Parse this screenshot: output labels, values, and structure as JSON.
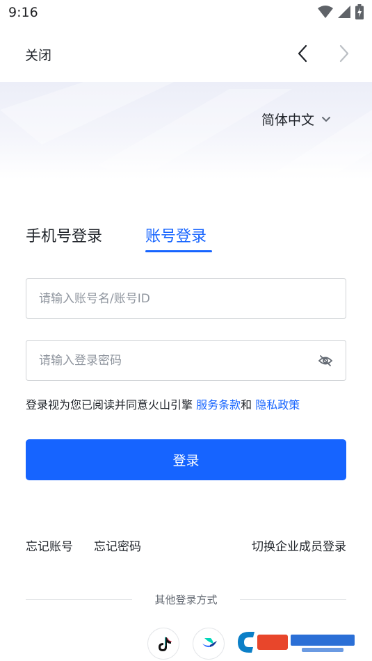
{
  "status_bar": {
    "time": "9:16"
  },
  "nav": {
    "close_label": "关闭"
  },
  "language": {
    "selected": "简体中文"
  },
  "tabs": {
    "phone_login": "手机号登录",
    "account_login": "账号登录"
  },
  "form": {
    "account_placeholder": "请输入账号名/账号ID",
    "account_value": "",
    "password_placeholder": "请输入登录密码",
    "password_value": ""
  },
  "agreement": {
    "prefix": "登录视为您已阅读并同意火山引擎 ",
    "terms_link": "服务条款",
    "and": "和 ",
    "privacy_link": "隐私政策"
  },
  "login_button_label": "登录",
  "links": {
    "forgot_account": "忘记账号",
    "forgot_password": "忘记密码",
    "enterprise_login": "切换企业成员登录"
  },
  "other_login": {
    "label": "其他登录方式"
  },
  "colors": {
    "primary": "#1664ff",
    "text": "#1f2329",
    "placeholder": "#8f959e",
    "border": "#d0d3d6"
  },
  "icons": [
    "wifi-icon",
    "signal-icon",
    "battery-icon",
    "back-arrow-icon",
    "forward-arrow-icon",
    "chevron-down-icon",
    "eye-off-icon",
    "douyin-icon",
    "feishu-icon"
  ]
}
